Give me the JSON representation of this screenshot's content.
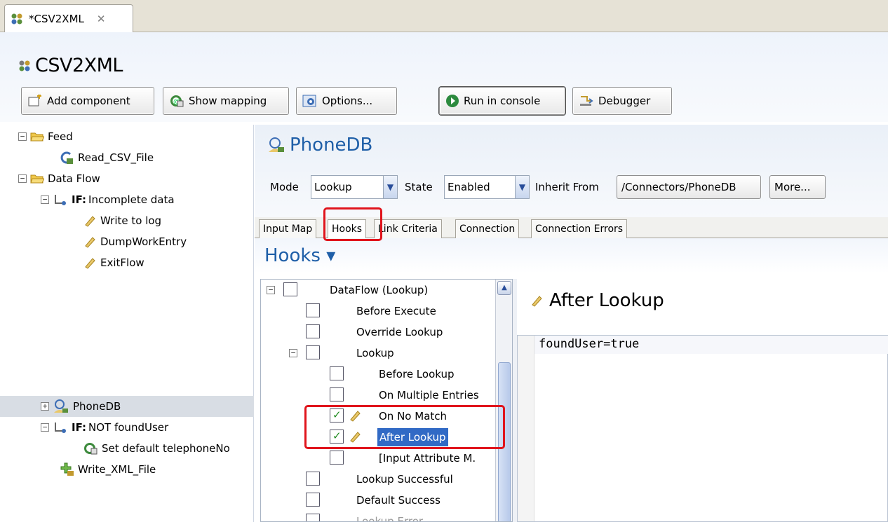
{
  "editor_tab": {
    "label": "*CSV2XML",
    "close": "✕"
  },
  "editor": {
    "title": "CSV2XML"
  },
  "toolbar": {
    "add_component": "Add component",
    "show_mapping": "Show mapping",
    "options": "Options...",
    "run_in_console": "Run in console",
    "debugger": "Debugger"
  },
  "tree": {
    "feed": "Feed",
    "read_csv": "Read_CSV_File",
    "data_flow": "Data Flow",
    "if_incomplete_prefix": "IF:",
    "if_incomplete": "Incomplete data",
    "write_to_log": "Write to log",
    "dump_work_entry": "DumpWorkEntry",
    "exit_flow": "ExitFlow",
    "phonedb": "PhoneDB",
    "if_not_prefix": "IF:",
    "if_not": "NOT foundUser",
    "set_default": "Set default telephoneNo",
    "write_xml": "Write_XML_File",
    "expand_minus": "−",
    "expand_plus": "+"
  },
  "component": {
    "title": "PhoneDB",
    "mode_label": "Mode",
    "mode_value": "Lookup",
    "state_label": "State",
    "state_value": "Enabled",
    "inherit_label": "Inherit From",
    "inherit_value": "/Connectors/PhoneDB",
    "more": "More..."
  },
  "subtabs": [
    "Input Map",
    "Hooks",
    "Link Criteria",
    "Connection",
    "Connection Errors"
  ],
  "hooks": {
    "title": "Hooks ▾",
    "items": {
      "dataflow": "DataFlow (Lookup)",
      "before_execute": "Before Execute",
      "override_lookup": "Override Lookup",
      "lookup": "Lookup",
      "before_lookup": "Before Lookup",
      "on_multiple": "On Multiple Entries",
      "on_no_match": "On No Match",
      "after_lookup": "After Lookup",
      "input_attr": "[Input Attribute M.",
      "lookup_successful": "Lookup Successful",
      "default_success": "Default Success",
      "lookup_error": "Lookup Error"
    },
    "checked": {
      "on_no_match": true,
      "after_lookup": true
    },
    "selected": "After Lookup"
  },
  "script_editor": {
    "title": "After Lookup",
    "code": "foundUser=true"
  },
  "colors": {
    "accent": "#1f5fa8",
    "highlight": "#e0141c",
    "selection": "#316ac5"
  }
}
